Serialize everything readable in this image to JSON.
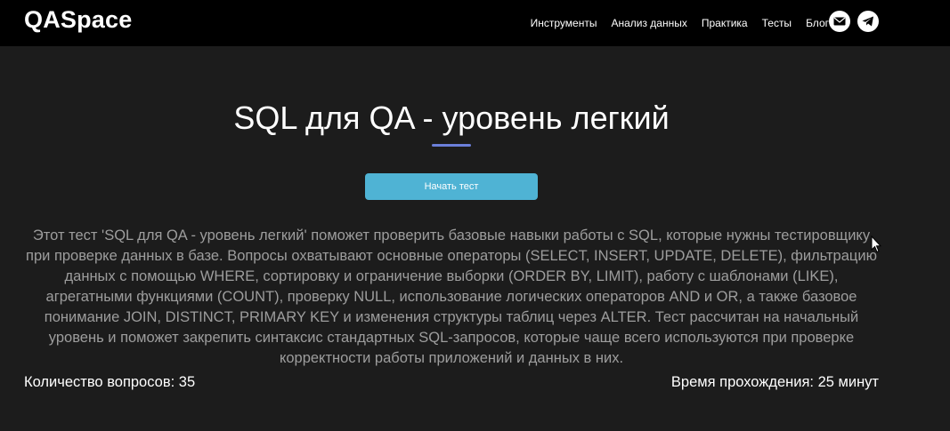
{
  "header": {
    "logo": "QASpace",
    "nav": [
      "Инструменты",
      "Анализ данных",
      "Практика",
      "Тесты",
      "Блог"
    ],
    "icons": [
      "mail-icon",
      "telegram-icon"
    ]
  },
  "main": {
    "title": "SQL для QA - уровень легкий",
    "start_button": "Начать тест",
    "description": "Этот тест 'SQL для QA - уровень легкий' поможет проверить базовые навыки работы с SQL, которые нужны тестировщику при проверке данных в базе. Вопросы охватывают основные операторы (SELECT, INSERT, UPDATE, DELETE), фильтрацию данных с помощью WHERE, сортировку и ограничение выборки (ORDER BY, LIMIT), работу с шаблонами (LIKE), агрегатными функциями (COUNT), проверку NULL, использование логических операторов AND и OR, а также базовое понимание JOIN, DISTINCT, PRIMARY KEY и изменения структуры таблиц через ALTER. Тест рассчитан на начальный уровень и поможет закрепить синтаксис стандартных SQL-запросов, которые чаще всего используются при проверке корректности работы приложений и данных в них.",
    "question_count": "Количество вопросов: 35",
    "duration": "Время прохождения: 25 минут"
  },
  "colors": {
    "background": "#1c1c1c",
    "topbar": "#000000",
    "button": "#4fb3d4",
    "accent_underline": "#6b7fd9",
    "description_text": "#9d9d9d"
  }
}
